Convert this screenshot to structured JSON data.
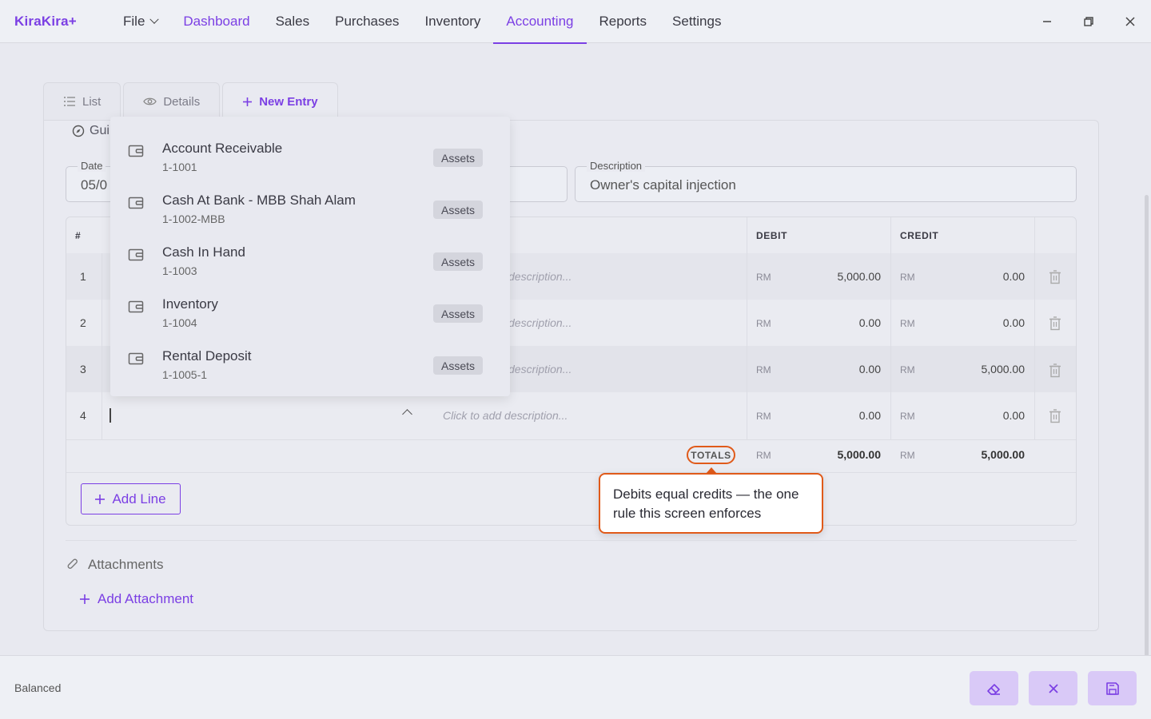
{
  "app": {
    "logo": "KiraKira+"
  },
  "menu": {
    "file": "File",
    "dashboard": "Dashboard",
    "sales": "Sales",
    "purchases": "Purchases",
    "inventory": "Inventory",
    "accounting": "Accounting",
    "reports": "Reports",
    "settings": "Settings"
  },
  "tabs": {
    "list": "List",
    "details": "Details",
    "new_entry": "New Entry"
  },
  "form": {
    "guide_label": "Gui",
    "date_label": "Date",
    "date_value": "05/0",
    "description_label": "Description",
    "description_value": "Owner's capital injection"
  },
  "table": {
    "headers": {
      "num": "#",
      "debit": "DEBIT",
      "credit": "CREDIT"
    },
    "currency": "RM",
    "description_placeholder_partial": "description...",
    "description_placeholder": "Click to add description...",
    "rows": [
      {
        "num": "1",
        "debit": "5,000.00",
        "credit": "0.00"
      },
      {
        "num": "2",
        "debit": "0.00",
        "credit": "0.00"
      },
      {
        "num": "3",
        "debit": "0.00",
        "credit": "5,000.00"
      },
      {
        "num": "4",
        "debit": "0.00",
        "credit": "0.00"
      }
    ],
    "totals_label": "TOTALS",
    "total_debit": "5,000.00",
    "total_credit": "5,000.00"
  },
  "tooltip": {
    "text": "Debits equal credits — the one rule this screen enforces"
  },
  "actions": {
    "add_line": "Add Line",
    "attachments": "Attachments",
    "add_attachment": "Add Attachment"
  },
  "dropdown": {
    "items": [
      {
        "name": "Account Receivable",
        "code": "1-1001",
        "type": "Assets"
      },
      {
        "name": "Cash At Bank - MBB Shah Alam",
        "code": "1-1002-MBB",
        "type": "Assets"
      },
      {
        "name": "Cash In Hand",
        "code": "1-1003",
        "type": "Assets"
      },
      {
        "name": "Inventory",
        "code": "1-1004",
        "type": "Assets"
      },
      {
        "name": "Rental Deposit",
        "code": "1-1005-1",
        "type": "Assets"
      }
    ]
  },
  "footer": {
    "status": "Balanced"
  },
  "colors": {
    "accent": "#7b3fe4",
    "highlight": "#e05a1a",
    "button_bg": "#d9c9f7"
  }
}
